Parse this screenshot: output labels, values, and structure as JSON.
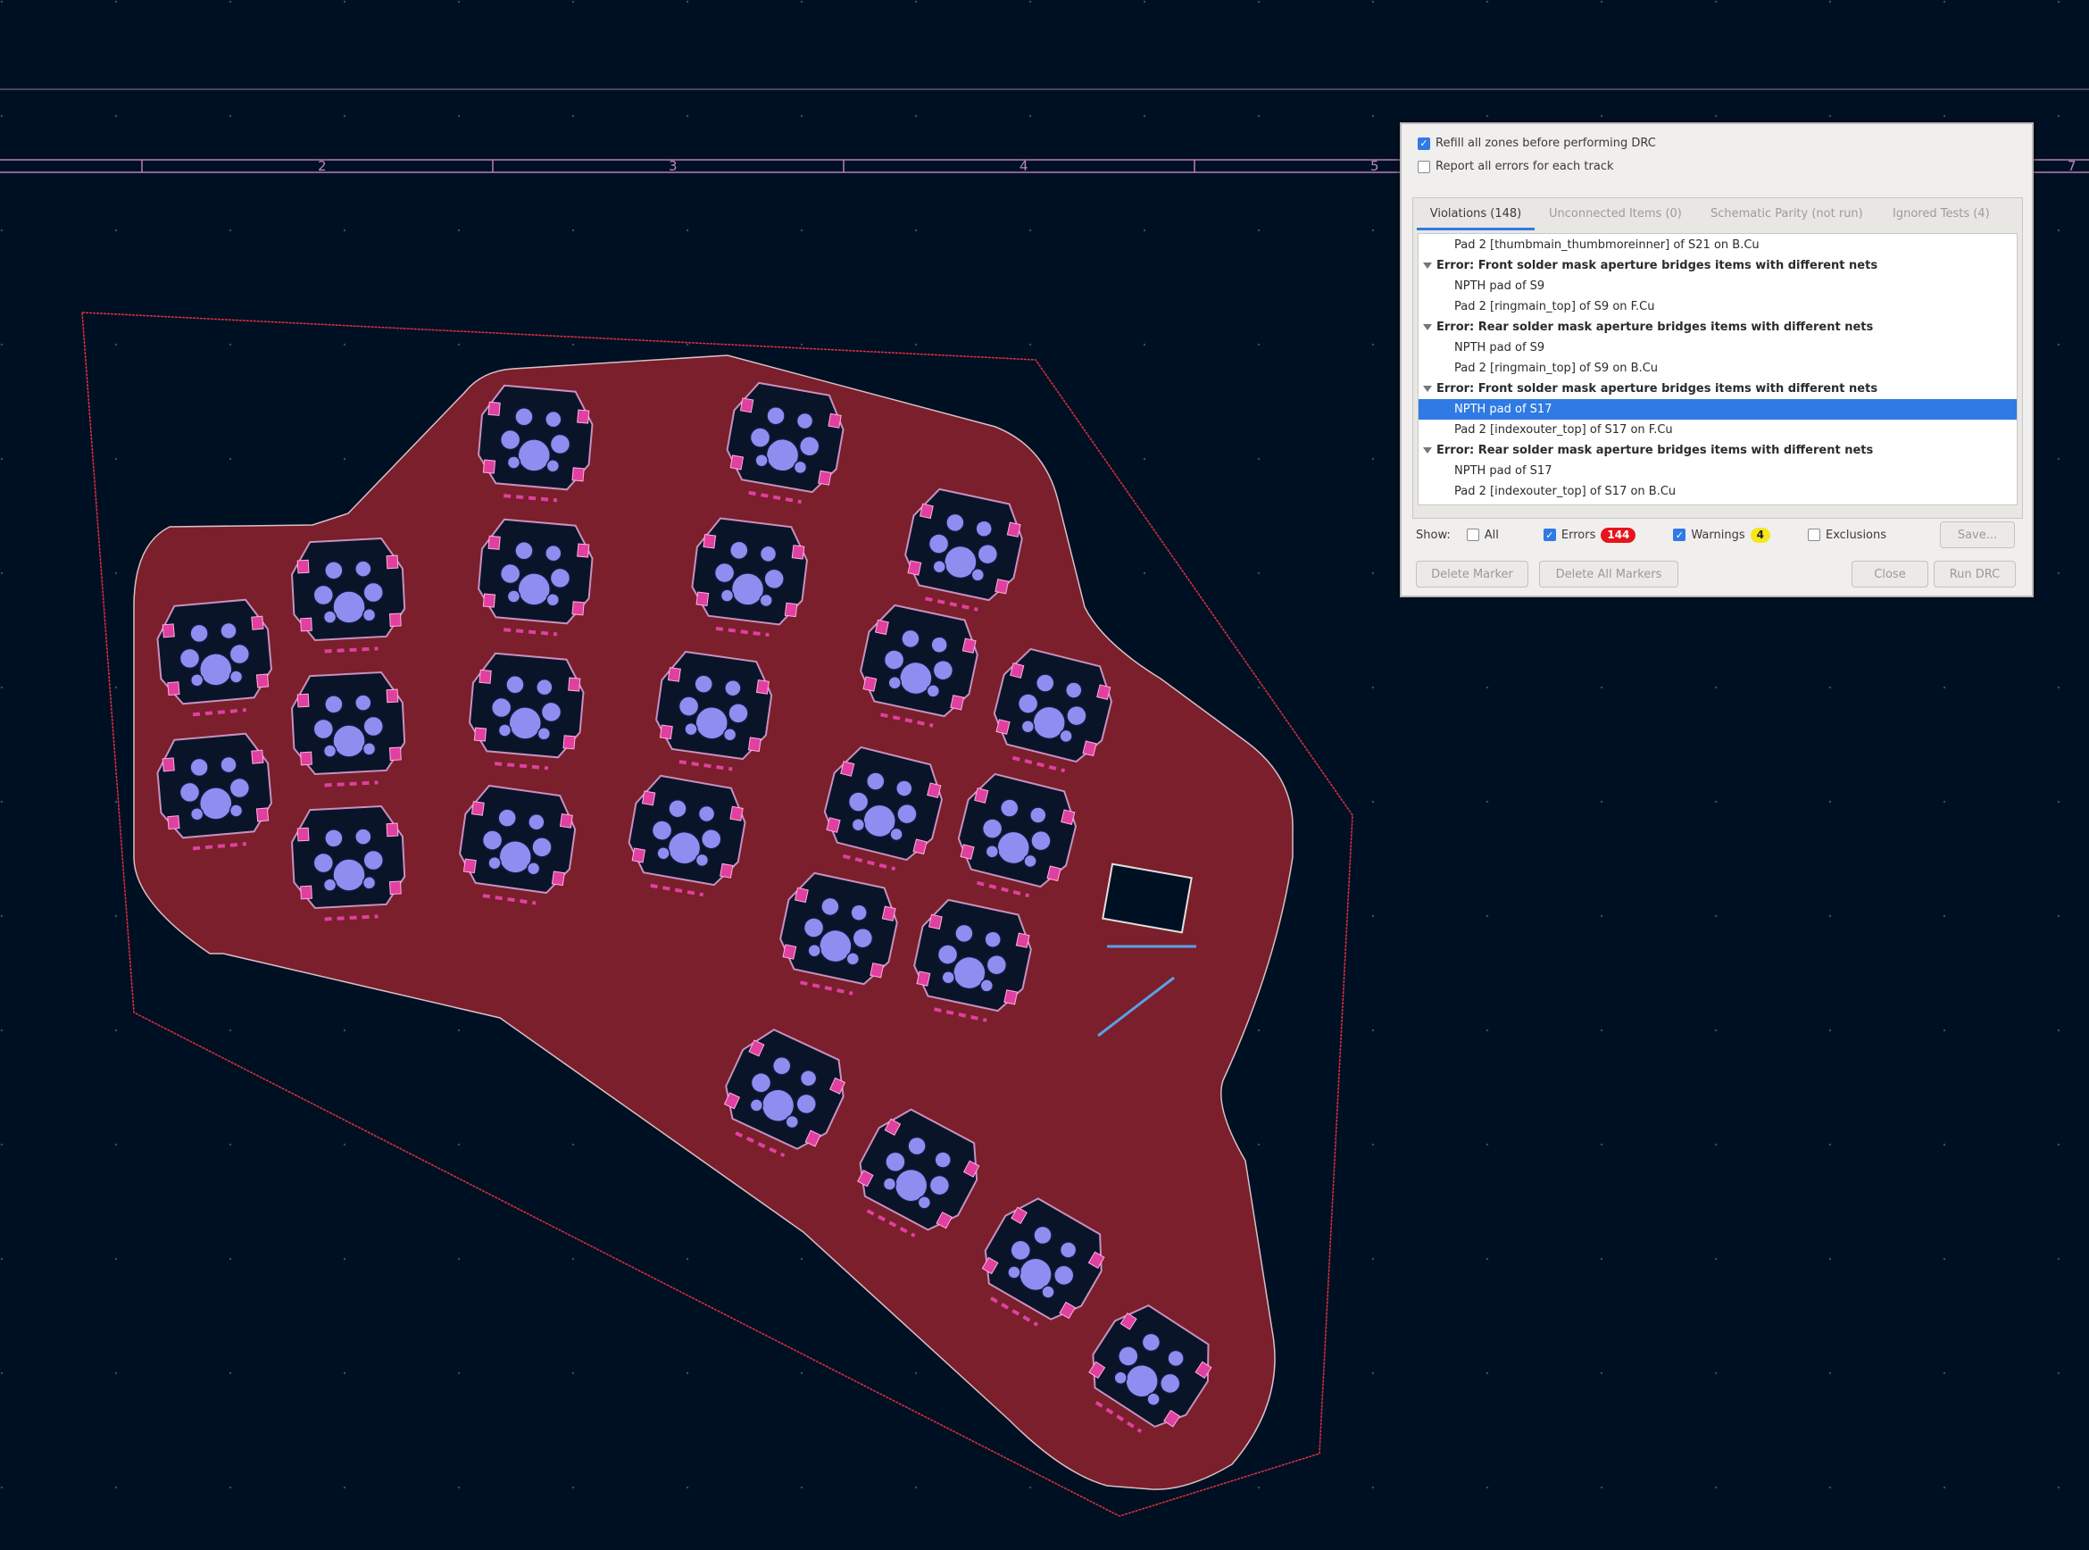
{
  "ruler": {
    "labels": [
      "2",
      "3",
      "4",
      "5",
      "7"
    ]
  },
  "drc": {
    "options": {
      "refill_zones": {
        "label": "Refill all zones before performing DRC",
        "checked": true
      },
      "report_all_errors": {
        "label": "Report all errors for each track",
        "checked": false
      }
    },
    "tabs": [
      {
        "label": "Violations (148)",
        "active": true
      },
      {
        "label": "Unconnected Items (0)",
        "active": false
      },
      {
        "label": "Schematic Parity (not run)",
        "active": false
      },
      {
        "label": "Ignored Tests (4)",
        "active": false
      }
    ],
    "violations": [
      {
        "kind": "item",
        "text": "Pad 2 [thumbmain_thumbmoreinner] of S21 on B.Cu"
      },
      {
        "kind": "error",
        "text": "Error: Front solder mask aperture bridges items with different nets"
      },
      {
        "kind": "item",
        "text": "NPTH pad of S9"
      },
      {
        "kind": "item",
        "text": "Pad 2 [ringmain_top] of S9 on F.Cu"
      },
      {
        "kind": "error",
        "text": "Error: Rear solder mask aperture bridges items with different nets"
      },
      {
        "kind": "item",
        "text": "NPTH pad of S9"
      },
      {
        "kind": "item",
        "text": "Pad 2 [ringmain_top] of S9 on B.Cu"
      },
      {
        "kind": "error",
        "text": "Error: Front solder mask aperture bridges items with different nets"
      },
      {
        "kind": "item",
        "text": "NPTH pad of S17",
        "selected": true
      },
      {
        "kind": "item",
        "text": "Pad 2 [indexouter_top] of S17 on F.Cu"
      },
      {
        "kind": "error",
        "text": "Error: Rear solder mask aperture bridges items with different nets"
      },
      {
        "kind": "item",
        "text": "NPTH pad of S17"
      },
      {
        "kind": "item",
        "text": "Pad 2 [indexouter_top] of S17 on B.Cu"
      }
    ],
    "show": {
      "label": "Show:",
      "all": {
        "label": "All",
        "checked": false
      },
      "errors": {
        "label": "Errors",
        "checked": true,
        "count": "144",
        "badge_color": "#e8141b"
      },
      "warnings": {
        "label": "Warnings",
        "checked": true,
        "count": "4",
        "badge_color": "#f4e81c"
      },
      "exclusions": {
        "label": "Exclusions",
        "checked": false
      }
    },
    "buttons": {
      "save": "Save...",
      "delete_marker": "Delete Marker",
      "delete_all_markers": "Delete All Markers",
      "close": "Close",
      "run_drc": "Run DRC"
    }
  },
  "colors": {
    "background": "#001023",
    "board_fill": "#7a1f2b",
    "edge_cuts": "#e03040",
    "pad": "#e040a0",
    "hole": "#8e8ef0",
    "accent": "#2f7ae5"
  }
}
